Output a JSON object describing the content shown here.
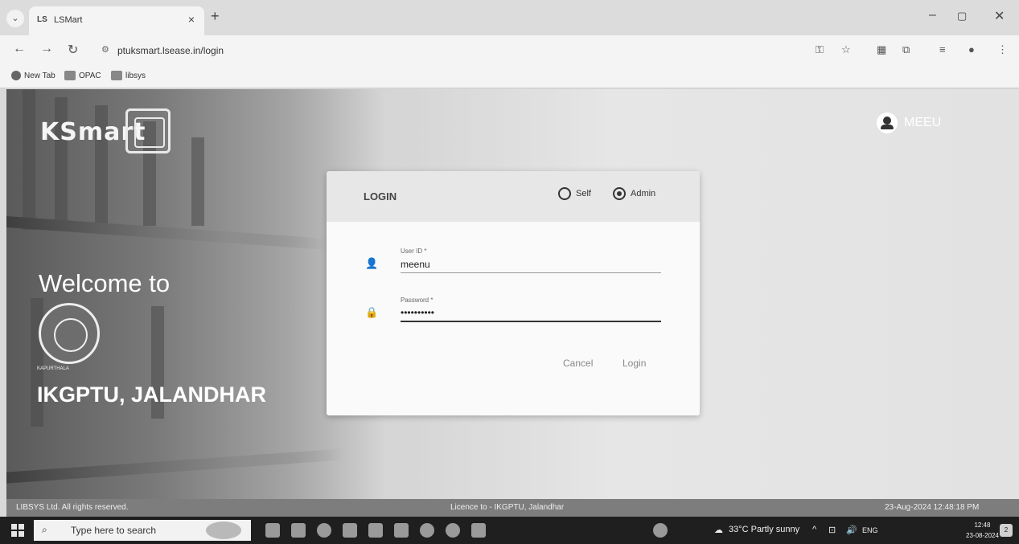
{
  "browser": {
    "tab_favicon": "LS",
    "tab_title": "LSMart",
    "tab_close": "×",
    "new_tab": "+",
    "url": "ptuksmart.lsease.in/login",
    "bookmarks": [
      {
        "label": "New Tab",
        "icon": "globe-icon"
      },
      {
        "label": "OPAC",
        "icon": "bookmark-icon"
      },
      {
        "label": "libsys",
        "icon": "bookmark-icon"
      }
    ]
  },
  "page": {
    "brand": "KSmart",
    "user_name": "MEEU",
    "welcome": "Welcome to",
    "seal_caption": "KAPURTHALA",
    "university": "IKGPTU, JALANDHAR"
  },
  "login": {
    "title": "LOGIN",
    "mode_options": [
      "Self",
      "Admin"
    ],
    "selected_mode": "Admin",
    "user_id_label": "User ID *",
    "user_id_value": "meenu",
    "password_label": "Password *",
    "password_value": "••••••••••",
    "cancel_label": "Cancel",
    "login_label": "Login"
  },
  "footer": {
    "left": "LIBSYS Ltd. All rights reserved.",
    "center": "Licence to - IKGPTU, Jalandhar",
    "right": "23-Aug-2024 12:48:18 PM"
  },
  "taskbar": {
    "search_placeholder": "Type here to search",
    "weather": "33°C  Partly sunny",
    "lang": "ENG",
    "time": "12:48",
    "date": "23-08-2024",
    "notification_count": "2"
  },
  "colors": {
    "card_header": "#e7e7e7",
    "footer": "#7d7d7d",
    "taskbar": "#1f1f1f"
  }
}
